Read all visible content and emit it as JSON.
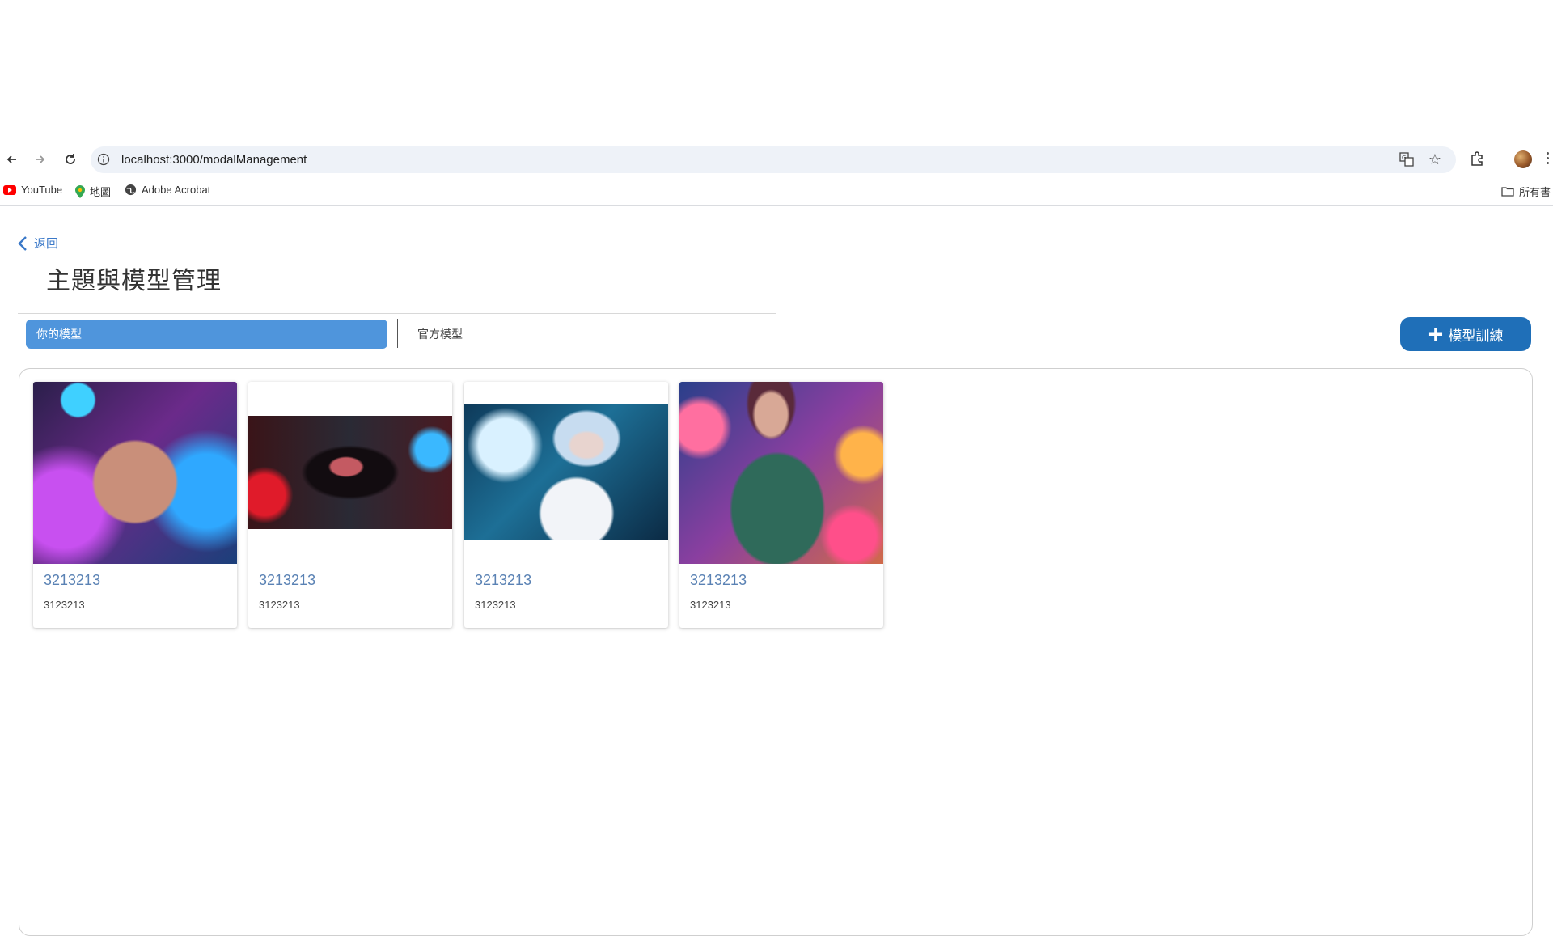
{
  "browser": {
    "url": "localhost:3000/modalManagement",
    "bookmarks": [
      {
        "label": "YouTube",
        "icon": "youtube-icon"
      },
      {
        "label": "地圖",
        "icon": "maps-pin-icon"
      },
      {
        "label": "Adobe Acrobat",
        "icon": "globe-icon"
      }
    ],
    "all_bookmarks_label": "所有書"
  },
  "page": {
    "back_label": "返回",
    "title": "主題與模型管理"
  },
  "tabs": [
    {
      "label": "你的模型",
      "active": true
    },
    {
      "label": "官方模型",
      "active": false
    }
  ],
  "train_button": {
    "label": "模型訓練",
    "icon": "plus-icon"
  },
  "cards": [
    {
      "name": "3213213",
      "description": "3123213"
    },
    {
      "name": "3213213",
      "description": "3123213"
    },
    {
      "name": "3213213",
      "description": "3123213"
    },
    {
      "name": "3213213",
      "description": "3123213"
    }
  ],
  "colors": {
    "accent": "#4f95dc",
    "primary_button": "#1f6fb8",
    "link": "#3a78c8",
    "card_title": "#5a82b4"
  }
}
